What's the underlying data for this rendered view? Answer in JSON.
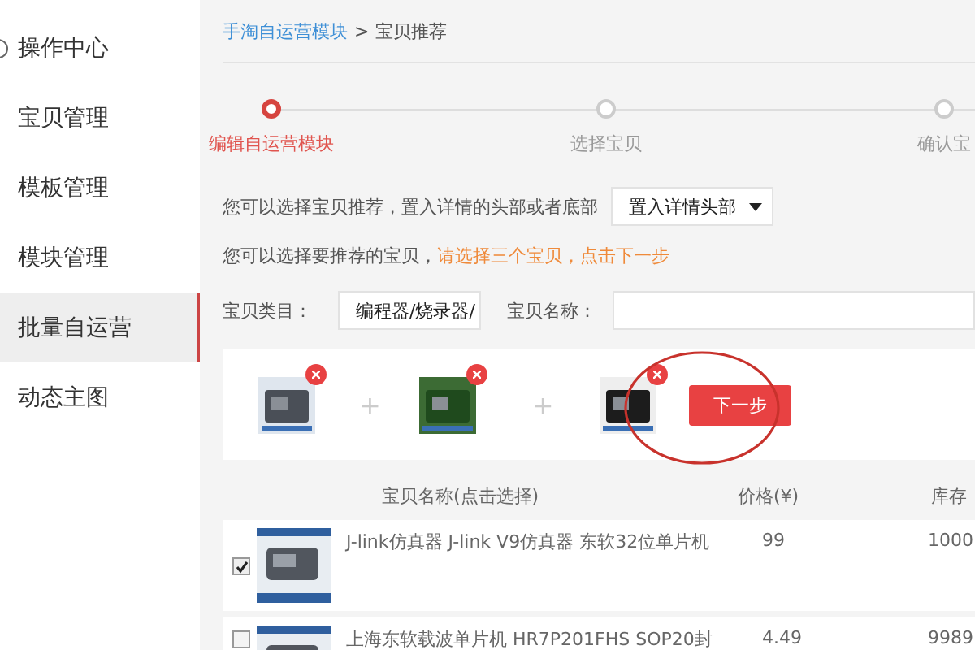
{
  "sidebar": {
    "items": [
      {
        "label": "操作中心",
        "selected": false
      },
      {
        "label": "宝贝管理",
        "selected": false
      },
      {
        "label": "模板管理",
        "selected": false
      },
      {
        "label": "模块管理",
        "selected": false
      },
      {
        "label": "批量自运营",
        "selected": true
      },
      {
        "label": "动态主图",
        "selected": false
      }
    ]
  },
  "breadcrumb": {
    "link": "手淘自运营模块",
    "separator": ">",
    "current": "宝贝推荐"
  },
  "steps": [
    {
      "label": "编辑自运营模块",
      "selected": true
    },
    {
      "label": "选择宝贝",
      "selected": false
    },
    {
      "label": "确认宝",
      "selected": false
    }
  ],
  "placement": {
    "text": "您可以选择宝贝推荐，置入详情的头部或者底部",
    "value": "置入详情头部"
  },
  "hint": {
    "text": "您可以选择要推荐的宝贝，",
    "highlight": "请选择三个宝贝，点击下一步"
  },
  "filters": {
    "category_label": "宝贝类目：",
    "category_value": "编程器/烧录器/",
    "name_label": "宝贝名称："
  },
  "chosen": [
    {
      "kind": "picture",
      "plus": "+"
    },
    {
      "kind": "picture",
      "plus": "+"
    },
    {
      "kind": "picture"
    }
  ],
  "next_button": "下一步",
  "table": {
    "columns": [
      "宝贝名称(点击选择)",
      "价格(¥)",
      "库存"
    ],
    "rows": [
      {
        "checked": true,
        "name": "J-link仿真器 J-link V9仿真器 东软32位单片机",
        "price": "99",
        "stock": "1000"
      },
      {
        "checked": false,
        "name": "上海东软载波单片机 HR7P201FHS SOP20封",
        "price": "4.49",
        "stock": "9989"
      }
    ]
  }
}
